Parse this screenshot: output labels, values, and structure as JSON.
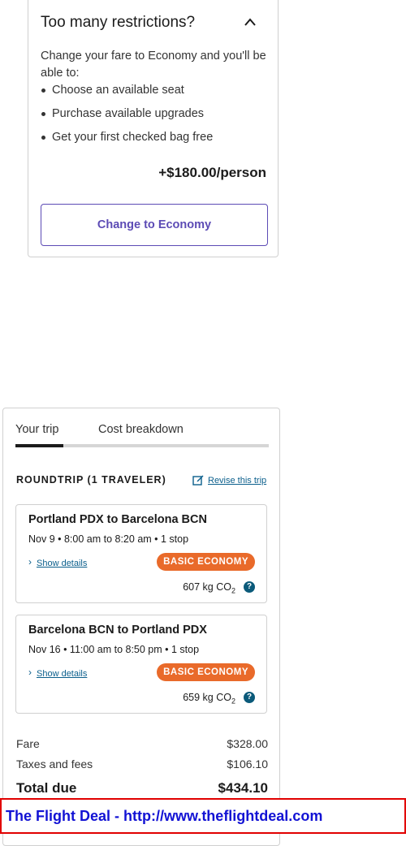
{
  "restrictions": {
    "title": "Too many restrictions?",
    "description": "Change your fare to Economy and you'll be able to:",
    "benefits": [
      "Choose an available seat",
      "Purchase available upgrades",
      "Get your first checked bag free"
    ],
    "price": "+$180.00/person",
    "button_label": "Change to Economy",
    "collapse_icon": "chevron-up-icon"
  },
  "trip": {
    "tabs": [
      "Your trip",
      "Cost breakdown"
    ],
    "active_tab": "Your trip",
    "roundtrip_label": "ROUNDTRIP (1 TRAVELER)",
    "revise_label": "Revise this trip",
    "flights": [
      {
        "route": "Portland PDX to Barcelona BCN",
        "details": "Nov 9 • 8:00 am to 8:20 am • 1 stop",
        "show_details": "Show details",
        "badge": "BASIC ECONOMY",
        "co2_value": "607 kg CO",
        "co2_sub": "2",
        "help": "?"
      },
      {
        "route": "Barcelona BCN to Portland PDX",
        "details": "Nov 16 • 11:00 am to 8:50 pm • 1 stop",
        "show_details": "Show details",
        "badge": "BASIC ECONOMY",
        "co2_value": "659 kg CO",
        "co2_sub": "2",
        "help": "?"
      }
    ],
    "costs": {
      "fare_label": "Fare",
      "fare_value": "$328.00",
      "taxes_label": "Taxes and fees",
      "taxes_value": "$106.10",
      "total_label": "Total due",
      "total_value": "$434.10"
    }
  },
  "banner": {
    "text": "The Flight Deal - http://www.theflightdeal.com"
  },
  "colors": {
    "accent_purple": "#5c4bb5",
    "badge_orange": "#e96a2a",
    "link_blue": "#0b5f8c",
    "banner_border": "#e10000",
    "banner_text": "#1212d4"
  }
}
